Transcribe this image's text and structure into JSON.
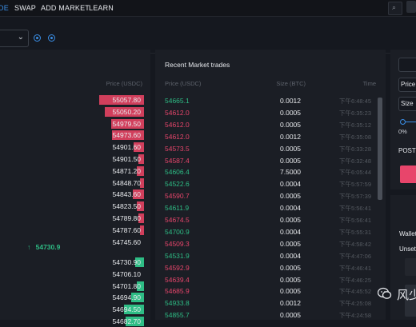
{
  "nav": {
    "items": [
      {
        "label": "DE",
        "active": true
      },
      {
        "label": "SWAP",
        "active": false
      },
      {
        "label": "ADD MARKET",
        "active": false
      },
      {
        "label": "LEARN",
        "active": false
      }
    ],
    "search_icon": "search-icon"
  },
  "subbar": {
    "chevron": "chevron-down-icon",
    "icons": [
      "info-icon",
      "info-icon"
    ]
  },
  "orderbook": {
    "price_header": "Price (USDC)",
    "asks": [
      {
        "price": "55057.80",
        "depth": 0.31
      },
      {
        "price": "55050.20",
        "depth": 0.27
      },
      {
        "price": "54979.50",
        "depth": 0.23
      },
      {
        "price": "54973.60",
        "depth": 0.22
      },
      {
        "price": "54901.60",
        "depth": 0.07
      },
      {
        "price": "54901.50",
        "depth": 0.04
      },
      {
        "price": "54871.20",
        "depth": 0.05
      },
      {
        "price": "54848.70",
        "depth": 0.03
      },
      {
        "price": "54843.60",
        "depth": 0.08
      },
      {
        "price": "54823.50",
        "depth": 0.05
      },
      {
        "price": "54789.80",
        "depth": 0.04
      },
      {
        "price": "54787.60",
        "depth": 0.03
      },
      {
        "price": "54745.60",
        "depth": 0
      }
    ],
    "mid_price": "54730.9",
    "mid_arrow": "↑",
    "bids": [
      {
        "price": "54730.90",
        "depth": 0.06
      },
      {
        "price": "54706.10",
        "depth": 0
      },
      {
        "price": "54701.80",
        "depth": 0.05
      },
      {
        "price": "54694.90",
        "depth": 0.09
      },
      {
        "price": "54694.50",
        "depth": 0.14
      },
      {
        "price": "54682.70",
        "depth": 0.13
      }
    ],
    "colors": {
      "ask": "#d13f5c",
      "bid": "#2ebd85"
    }
  },
  "trades": {
    "title": "Recent Market trades",
    "headers": {
      "price": "Price (USDC)",
      "size": "Size (BTC)",
      "time": "Time"
    },
    "rows": [
      {
        "price": "54665.1",
        "side": "buy",
        "size": "0.0012",
        "time": "下午6:48:45"
      },
      {
        "price": "54612.0",
        "side": "sell",
        "size": "0.0005",
        "time": "下午6:35:23"
      },
      {
        "price": "54612.0",
        "side": "sell",
        "size": "0.0005",
        "time": "下午6:35:12"
      },
      {
        "price": "54612.0",
        "side": "sell",
        "size": "0.0012",
        "time": "下午6:35:08"
      },
      {
        "price": "54573.5",
        "side": "sell",
        "size": "0.0005",
        "time": "下午6:33:28"
      },
      {
        "price": "54587.4",
        "side": "sell",
        "size": "0.0005",
        "time": "下午6:32:48"
      },
      {
        "price": "54606.4",
        "side": "buy",
        "size": "7.5000",
        "time": "下午6:05:44"
      },
      {
        "price": "54522.6",
        "side": "buy",
        "size": "0.0004",
        "time": "下午5:57:59"
      },
      {
        "price": "54590.7",
        "side": "sell",
        "size": "0.0005",
        "time": "下午5:57:39"
      },
      {
        "price": "54611.9",
        "side": "buy",
        "size": "0.0004",
        "time": "下午5:56:41"
      },
      {
        "price": "54674.5",
        "side": "sell",
        "size": "0.0005",
        "time": "下午5:56:41"
      },
      {
        "price": "54700.9",
        "side": "buy",
        "size": "0.0004",
        "time": "下午5:55:31"
      },
      {
        "price": "54509.3",
        "side": "sell",
        "size": "0.0005",
        "time": "下午4:58:42"
      },
      {
        "price": "54531.9",
        "side": "buy",
        "size": "0.0004",
        "time": "下午4:47:06"
      },
      {
        "price": "54592.9",
        "side": "sell",
        "size": "0.0005",
        "time": "下午4:46:41"
      },
      {
        "price": "54639.4",
        "side": "sell",
        "size": "0.0005",
        "time": "下午4:46:25"
      },
      {
        "price": "54685.9",
        "side": "sell",
        "size": "0.0005",
        "time": "下午4:45:52"
      },
      {
        "price": "54933.8",
        "side": "buy",
        "size": "0.0012",
        "time": "下午4:25:08"
      },
      {
        "price": "54855.7",
        "side": "buy",
        "size": "0.0005",
        "time": "下午4:24:58"
      }
    ],
    "colors": {
      "buy": "#2ebd85",
      "sell": "#e8456b"
    }
  },
  "order_form": {
    "price_label": "Price",
    "size_label": "Size",
    "percent": "0%",
    "post_label": "POST",
    "post_button_color": "#e8456b"
  },
  "wallet": {
    "title": "Wallet",
    "unset": "Unset"
  },
  "watermark": {
    "text": "风少",
    "icon": "wechat-icon"
  }
}
